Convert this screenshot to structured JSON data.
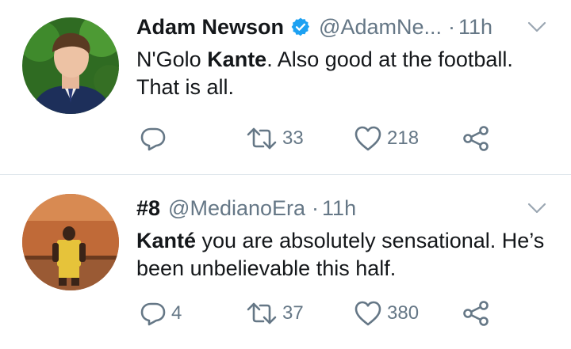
{
  "tweets": [
    {
      "name": "Adam Newson",
      "verified": true,
      "handle": "@AdamNe...",
      "dot": "·",
      "time": "11h",
      "text": {
        "p1": "N'Golo ",
        "b1": "Kante",
        "p2": ". Also good at the football. That is all."
      },
      "reply_count": "",
      "retweet_count": "33",
      "like_count": "218"
    },
    {
      "name": "#8",
      "verified": false,
      "handle": "@MedianoEra",
      "dot": "·",
      "time": "11h",
      "text": {
        "b1": "Kanté",
        "p2": " you are absolutely sensational. He’s been unbelievable this half."
      },
      "reply_count": "4",
      "retweet_count": "37",
      "like_count": "380"
    }
  ],
  "colors": {
    "accent": "#1da1f2",
    "muted": "#657786",
    "text": "#14171a",
    "divider": "#e1e8ed"
  }
}
